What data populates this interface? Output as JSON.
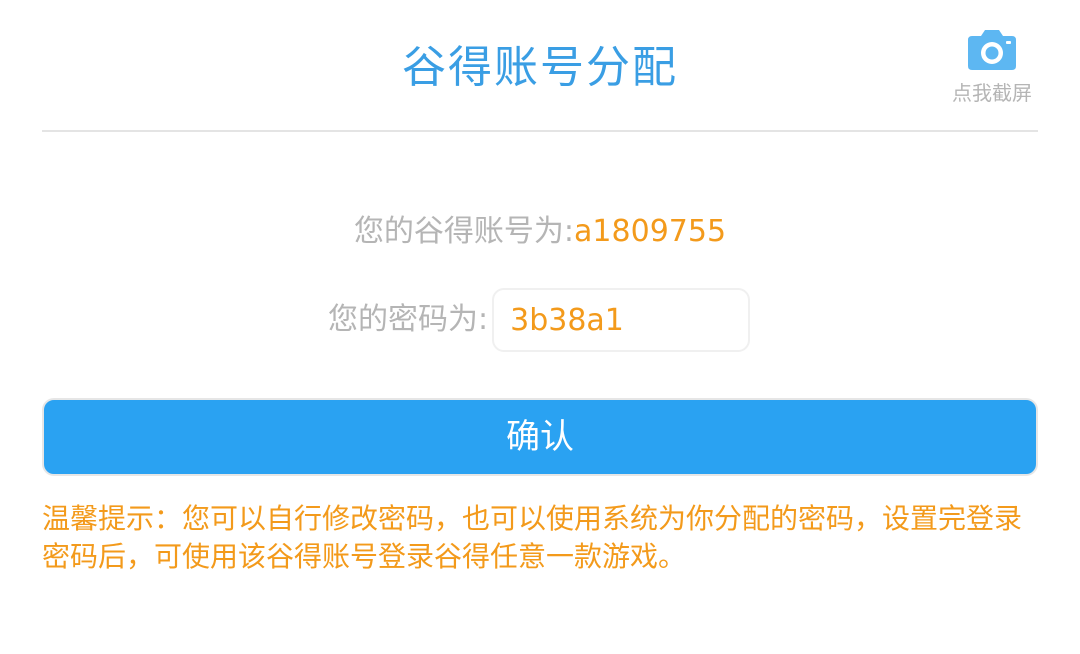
{
  "header": {
    "title": "谷得账号分配",
    "screenshot_label": "点我截屏",
    "screenshot_icon": "camera-icon"
  },
  "account": {
    "label": "您的谷得账号为:",
    "value": "a1809755"
  },
  "password": {
    "label": "您的密码为:",
    "value": "3b38a1"
  },
  "confirm": {
    "label": "确认"
  },
  "tip": {
    "text": "温馨提示：您可以自行修改密码，也可以使用系统为你分配的密码，设置完登录密码后，可使用该谷得账号登录谷得任意一款游戏。"
  },
  "colors": {
    "title": "#3a9ee4",
    "icon": "#5db7f2",
    "label_gray": "#b5b5b5",
    "orange": "#f39a1b",
    "button_bg": "#2aa2f2",
    "button_text": "#ffffff",
    "divider": "#e4e4e4"
  }
}
